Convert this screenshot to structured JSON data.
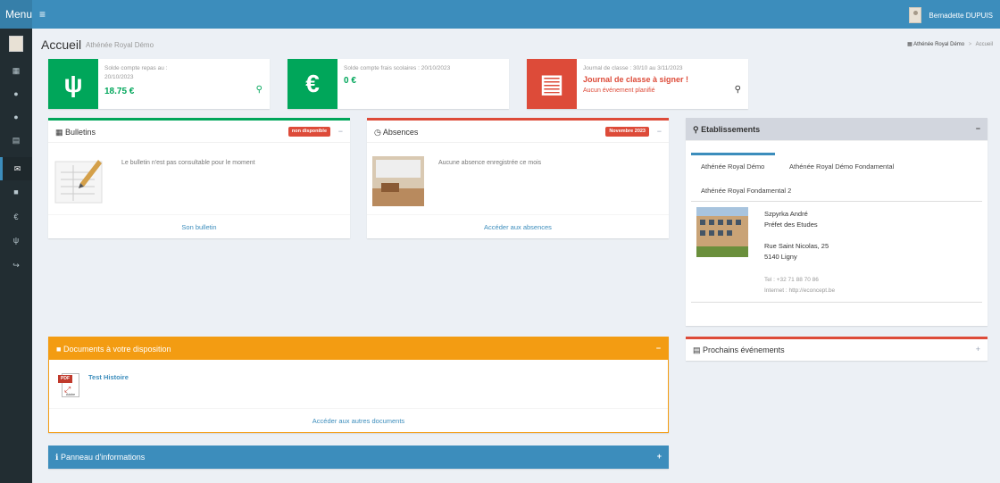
{
  "topbar": {
    "menu_label": "Menu",
    "hamburger_icon": "bars-icon",
    "user_name": "Bernadette DUPUIS"
  },
  "sidebar": {
    "items": [
      {
        "icon": "grid-icon",
        "glyph": "▦"
      },
      {
        "icon": "user-icon",
        "glyph": "●"
      },
      {
        "icon": "users-icon",
        "glyph": "●"
      },
      {
        "icon": "calendar-icon",
        "glyph": "▤"
      },
      {
        "icon": "envelope-icon",
        "glyph": "✉"
      },
      {
        "icon": "folder-icon",
        "glyph": "■"
      },
      {
        "icon": "euro-icon",
        "glyph": "€"
      },
      {
        "icon": "cutlery-icon",
        "glyph": "ψ"
      },
      {
        "icon": "share-icon",
        "glyph": "↪"
      }
    ]
  },
  "header": {
    "title": "Accueil",
    "subtitle": "Athénée Royal Démo",
    "breadcrumb": [
      "Athénée Royal Démo",
      "Accueil"
    ]
  },
  "info_boxes": [
    {
      "label_line1": "Solde compte repas au :",
      "label_line2": "20/10/2023",
      "value": "18.75 €",
      "value_color": "#00a65a",
      "color": "#00a65a",
      "icon": "cutlery-icon"
    },
    {
      "label_line1": "Solde compte frais scolaires : 20/10/2023",
      "value": "0 €",
      "value_color": "#00a65a",
      "color": "#00a65a",
      "icon": "euro-icon"
    },
    {
      "label_line1": "Journal de classe : 30/10 au 3/11/2023",
      "value": "Journal de classe à signer !",
      "value_color": "#dd4b39",
      "subtext": "Aucun événement planifié",
      "color": "#dd4b39",
      "icon": "book-icon"
    }
  ],
  "bulletins": {
    "title": "Bulletins",
    "badge": "non disponible",
    "text": "Le bulletin n'est pas consultable pour le moment",
    "footer": "Son bulletin"
  },
  "absences": {
    "title": "Absences",
    "badge": "Novembre 2023",
    "text": "Aucune absence enregistrée ce mois",
    "footer": "Accéder aux absences"
  },
  "etablissements": {
    "title": "Etablissements",
    "tabs": [
      "Athénée Royal Démo",
      "Athénée Royal Démo Fondamental",
      "Athénée Royal Fondamental 2"
    ],
    "contact_name": "Szpyrka André",
    "contact_role": "Préfet des Etudes",
    "street": "Rue Saint Nicolas, 25",
    "city": "5140 Ligny",
    "tel": "Tel : +32 71 88 70 86",
    "internet": "Internet : http://econcept.be"
  },
  "documents": {
    "title": "Documents à votre disposition",
    "file_name": "Test Histoire",
    "footer": "Accéder aux autres documents",
    "pdf_label": "PDF",
    "pdf_brand": "Adobe"
  },
  "events": {
    "title": "Prochains événements"
  },
  "info_panel": {
    "title": "Panneau d'informations"
  },
  "colors": {
    "primary": "#3c8dbc",
    "green": "#00a65a",
    "red": "#dd4b39",
    "orange": "#f39c12",
    "sidebar": "#222d32"
  }
}
